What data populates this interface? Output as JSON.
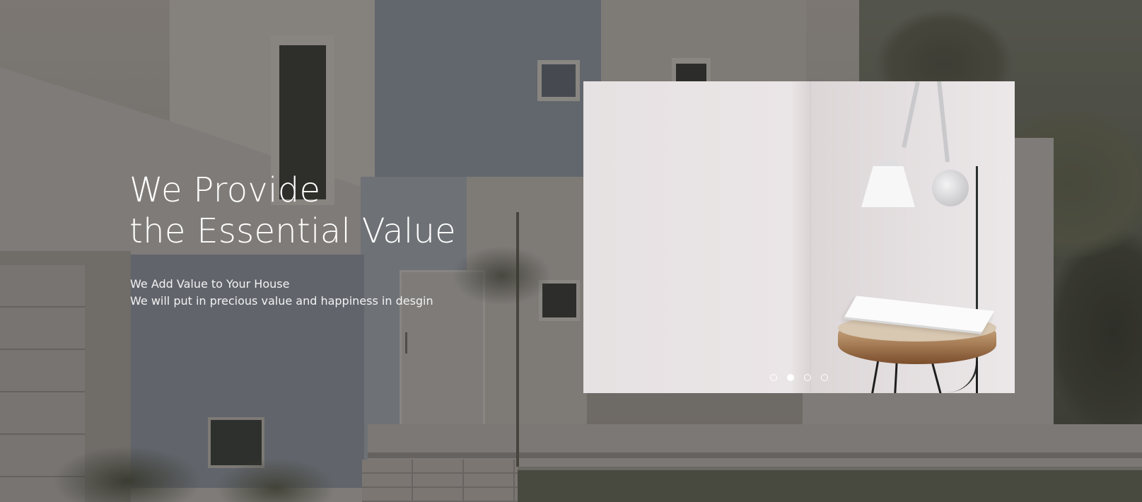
{
  "hero": {
    "headline_line1": "We Provide",
    "headline_line2": "the Essential Value",
    "subtext_line1": "We Add Value to Your House",
    "subtext_line2": "We will put in precious value and happiness in desgin"
  },
  "slider": {
    "slide_count": 4,
    "active_index": 1,
    "dots": [
      {
        "label": "slide-1",
        "active": false
      },
      {
        "label": "slide-2",
        "active": true
      },
      {
        "label": "slide-3",
        "active": false
      },
      {
        "label": "slide-4",
        "active": false
      }
    ]
  },
  "colors": {
    "text": "#ffffff",
    "dot": "#ffffff"
  }
}
